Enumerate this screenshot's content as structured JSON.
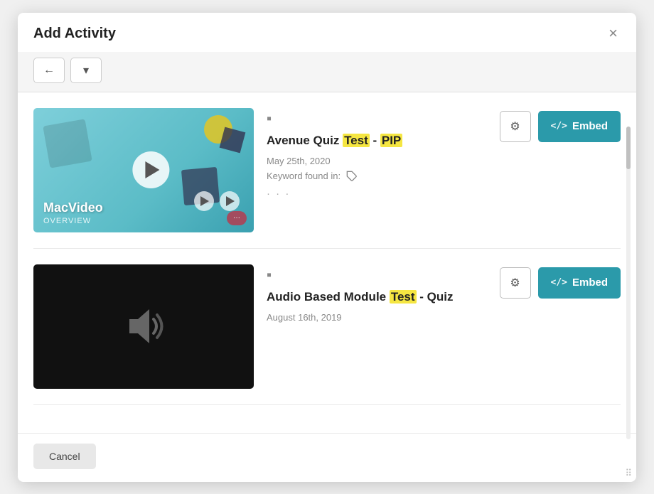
{
  "modal": {
    "title": "Add Activity",
    "close_label": "×"
  },
  "toolbar": {
    "back_label": "←",
    "down_label": "▾"
  },
  "items": [
    {
      "id": "item-1",
      "type_icon": "▪",
      "title_parts": [
        "Avenue Quiz ",
        "Test",
        " - ",
        "PIP"
      ],
      "title_full": "Avenue Quiz Test - PIP",
      "highlight_words": [
        "Test",
        "PIP"
      ],
      "date": "May 25th, 2020",
      "keyword_label": "Keyword found in:",
      "ellipsis": "· · ·",
      "has_keyword": true,
      "thumbnail_type": "video"
    },
    {
      "id": "item-2",
      "type_icon": "▪",
      "title_parts": [
        "Audio Based Module ",
        "Test",
        " - Quiz"
      ],
      "title_full": "Audio Based Module Test - Quiz",
      "highlight_words": [
        "Test"
      ],
      "date": "August 16th, 2019",
      "has_keyword": false,
      "thumbnail_type": "audio"
    }
  ],
  "actions": {
    "settings_label": "⚙",
    "embed_label": "Embed",
    "embed_code": "</>",
    "cancel_label": "Cancel"
  }
}
